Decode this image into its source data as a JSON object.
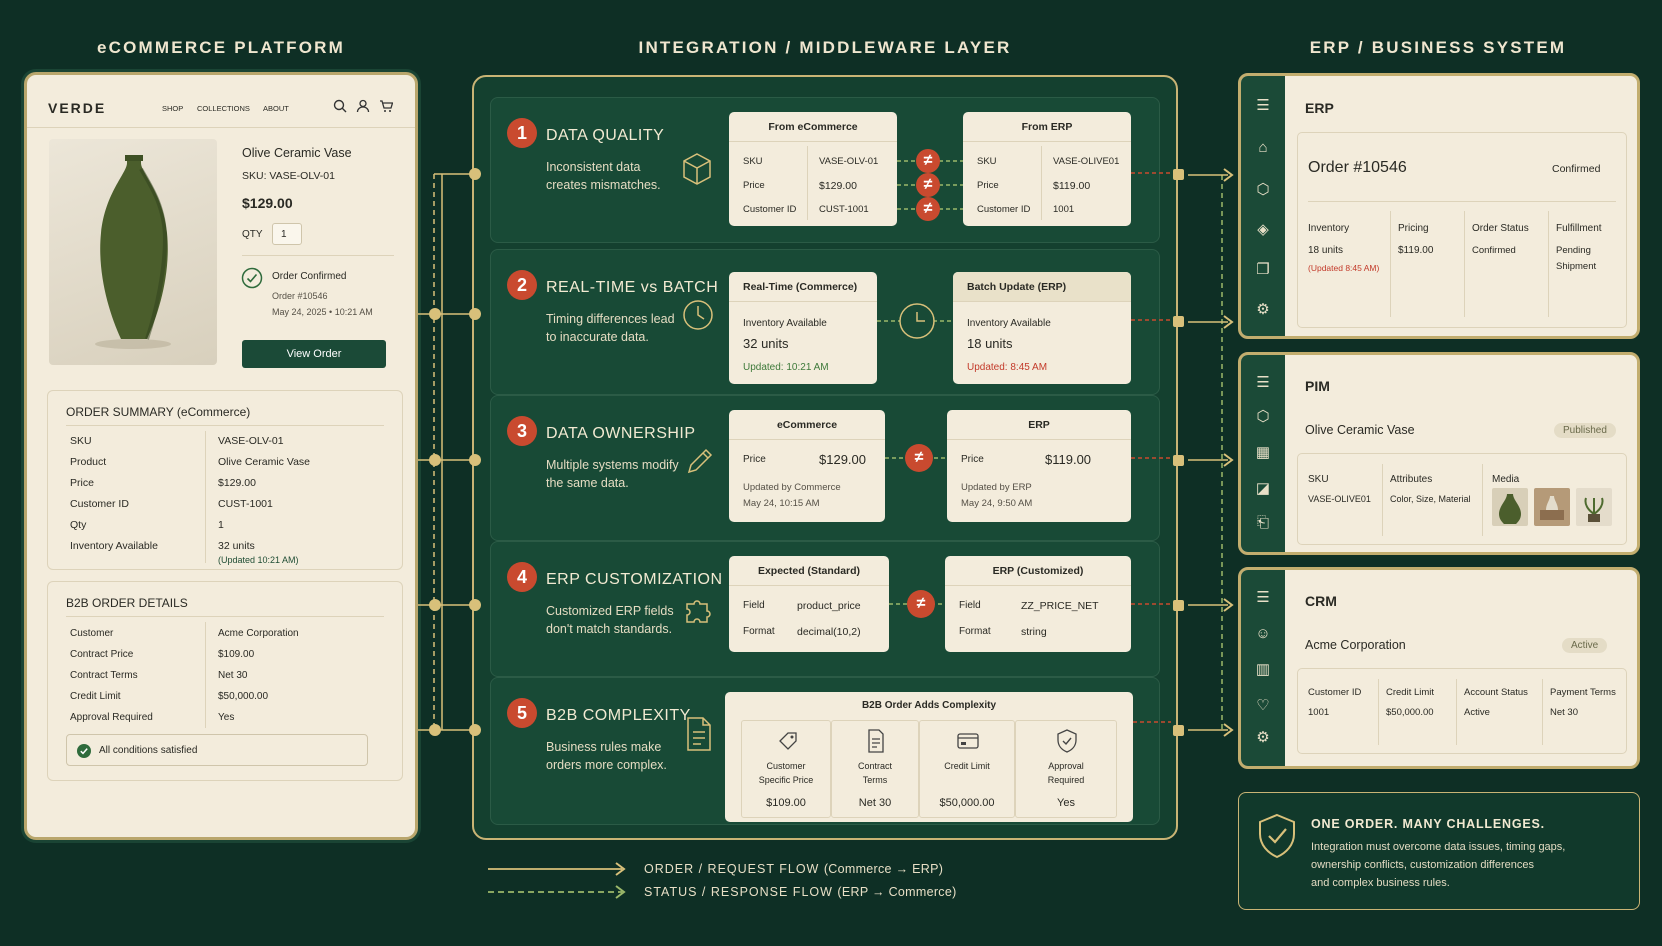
{
  "columns": {
    "left": "eCOMMERCE PLATFORM",
    "middle": "INTEGRATION / MIDDLEWARE LAYER",
    "right": "ERP / BUSINESS SYSTEM"
  },
  "ecom": {
    "brand": "VERDE",
    "nav": [
      "SHOP",
      "COLLECTIONS",
      "ABOUT"
    ],
    "product": {
      "name": "Olive Ceramic Vase",
      "sku": "SKU: VASE-OLV-01",
      "price": "$129.00",
      "qty_label": "QTY",
      "qty": "1"
    },
    "confirm": {
      "title": "Order Confirmed",
      "order": "Order #10546",
      "date": "May 24, 2025 • 10:21 AM",
      "button": "View Order"
    },
    "summary": {
      "title": "ORDER SUMMARY (eCommerce)",
      "rows": [
        [
          "SKU",
          "VASE-OLV-01"
        ],
        [
          "Product",
          "Olive Ceramic Vase"
        ],
        [
          "Price",
          "$129.00"
        ],
        [
          "Customer ID",
          "CUST-1001"
        ],
        [
          "Qty",
          "1"
        ],
        [
          "Inventory Available",
          "32 units"
        ]
      ],
      "inv_note": "(Updated 10:21 AM)"
    },
    "b2b": {
      "title": "B2B ORDER DETAILS",
      "rows": [
        [
          "Customer",
          "Acme Corporation"
        ],
        [
          "Contract Price",
          "$109.00"
        ],
        [
          "Contract Terms",
          "Net 30"
        ],
        [
          "Credit Limit",
          "$50,000.00"
        ],
        [
          "Approval Required",
          "Yes"
        ]
      ],
      "status": "All conditions satisfied"
    }
  },
  "mid": {
    "r1": {
      "num": "1",
      "title": "DATA QUALITY",
      "desc1": "Inconsistent data",
      "desc2": "creates mismatches.",
      "left": {
        "title": "From eCommerce",
        "rows": [
          [
            "SKU",
            "VASE-OLV-01"
          ],
          [
            "Price",
            "$129.00"
          ],
          [
            "Customer ID",
            "CUST-1001"
          ]
        ]
      },
      "right": {
        "title": "From ERP",
        "rows": [
          [
            "SKU",
            "VASE-OLIVE01"
          ],
          [
            "Price",
            "$119.00"
          ],
          [
            "Customer ID",
            "1001"
          ]
        ]
      },
      "neq": "≠"
    },
    "r2": {
      "num": "2",
      "title": "REAL-TIME vs BATCH",
      "desc1": "Timing differences lead",
      "desc2": "to inaccurate data.",
      "left": {
        "title": "Real-Time (Commerce)",
        "label": "Inventory Available",
        "value": "32 units",
        "updated": "Updated: 10:21 AM"
      },
      "right": {
        "title": "Batch Update (ERP)",
        "label": "Inventory Available",
        "value": "18 units",
        "updated": "Updated: 8:45 AM"
      }
    },
    "r3": {
      "num": "3",
      "title": "DATA OWNERSHIP",
      "desc1": "Multiple systems modify",
      "desc2": "the same data.",
      "left": {
        "title": "eCommerce",
        "label": "Price",
        "value": "$129.00",
        "u1": "Updated by Commerce",
        "u2": "May 24, 10:15 AM"
      },
      "right": {
        "title": "ERP",
        "label": "Price",
        "value": "$119.00",
        "u1": "Updated by ERP",
        "u2": "May 24, 9:50 AM"
      }
    },
    "r4": {
      "num": "4",
      "title": "ERP CUSTOMIZATION",
      "desc1": "Customized ERP fields",
      "desc2": "don't match standards.",
      "left": {
        "title": "Expected (Standard)",
        "rows": [
          [
            "Field",
            "product_price"
          ],
          [
            "Format",
            "decimal(10,2)"
          ]
        ]
      },
      "right": {
        "title": "ERP (Customized)",
        "rows": [
          [
            "Field",
            "ZZ_PRICE_NET"
          ],
          [
            "Format",
            "string"
          ]
        ]
      }
    },
    "r5": {
      "num": "5",
      "title": "B2B COMPLEXITY",
      "desc1": "Business rules make",
      "desc2": "orders more complex.",
      "box_title": "B2B Order Adds Complexity",
      "items": [
        {
          "l1": "Customer",
          "l2": "Specific Price",
          "v": "$109.00"
        },
        {
          "l1": "Contract",
          "l2": "Terms",
          "v": "Net 30"
        },
        {
          "l1": "Credit Limit",
          "l2": "",
          "v": "$50,000.00"
        },
        {
          "l1": "Approval",
          "l2": "Required",
          "v": "Yes"
        }
      ]
    }
  },
  "legend": {
    "order": "ORDER / REQUEST FLOW",
    "order_sub": "(Commerce → ERP)",
    "status": "STATUS / RESPONSE FLOW",
    "status_sub": "(ERP → Commerce)"
  },
  "erp": {
    "title": "ERP",
    "order": "Order #10546",
    "status": "Confirmed",
    "cols": [
      {
        "h": "Inventory",
        "v": "18 units",
        "n": "(Updated 8:45 AM)"
      },
      {
        "h": "Pricing",
        "v": "$119.00",
        "n": ""
      },
      {
        "h": "Order Status",
        "v": "Confirmed",
        "n": ""
      },
      {
        "h": "Fulfillment",
        "v": "Pending",
        "n": "Shipment"
      }
    ]
  },
  "pim": {
    "title": "PIM",
    "product": "Olive Ceramic Vase",
    "badge": "Published",
    "cols": [
      {
        "h": "SKU",
        "v": "VASE-OLIVE01"
      },
      {
        "h": "Attributes",
        "v": "Color, Size, Material"
      },
      {
        "h": "Media",
        "v": ""
      }
    ]
  },
  "crm": {
    "title": "CRM",
    "company": "Acme Corporation",
    "badge": "Active",
    "cols": [
      {
        "h": "Customer ID",
        "v": "1001"
      },
      {
        "h": "Credit Limit",
        "v": "$50,000.00"
      },
      {
        "h": "Account Status",
        "v": "Active"
      },
      {
        "h": "Payment Terms",
        "v": "Net 30"
      }
    ]
  },
  "callout": {
    "title": "ONE ORDER. MANY CHALLENGES.",
    "l1": "Integration must overcome data issues, timing gaps,",
    "l2": "ownership conflicts, customization differences",
    "l3": "and complex business rules."
  },
  "colors": {
    "bg": "#0e2f25",
    "panel": "#f3ecdc",
    "gold": "#d8c07a",
    "red": "#c94a2f",
    "green": "#1f4d34"
  }
}
